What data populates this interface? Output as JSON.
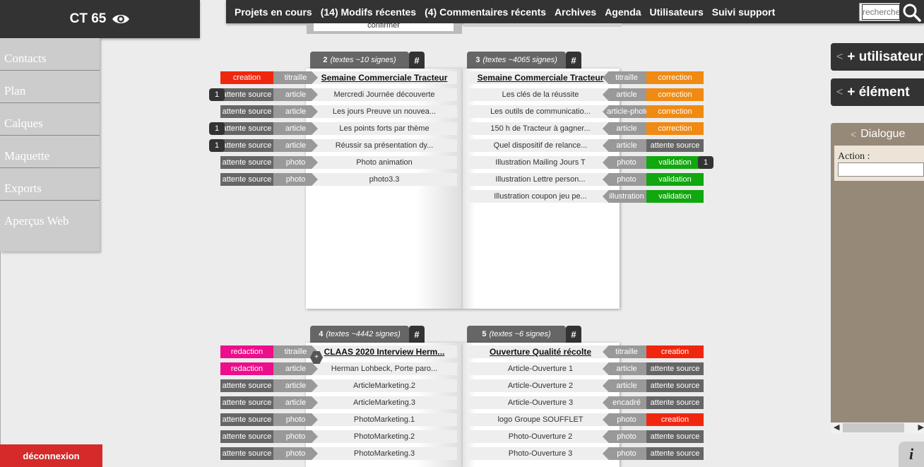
{
  "app": {
    "title": "CT 65",
    "eye_icon": "eye-icon"
  },
  "topnav": {
    "items": [
      "Projets en cours",
      "(14) Modifs récentes",
      "(4) Commentaires récents",
      "Archives",
      "Agenda",
      "Utilisateurs",
      "Suivi support"
    ],
    "search_placeholder": "recherche"
  },
  "confirm_label": "confirmer",
  "leftmenu": [
    "Contacts",
    "Plan",
    "Calques",
    "Maquette",
    "Exports",
    "Aperçus Web"
  ],
  "logout_label": "déconnexion",
  "colors": {
    "creation": "#f0270f",
    "redaction": "#ec0e8b",
    "source": "#666666",
    "correction": "#f08a12",
    "validation": "#10a70f",
    "type": "#999999"
  },
  "pages": [
    {
      "num": "2",
      "info": "(textes ~10 signes)",
      "hash": "#",
      "rows": [
        {
          "title": "Semaine Commerciale Tracteur",
          "headline": true,
          "type": "titraille",
          "status": "creation",
          "status_kind": "creation"
        },
        {
          "title": "Mercredi Journée découverte",
          "type": "article",
          "status": "attente source",
          "status_kind": "source",
          "count": "1"
        },
        {
          "title": "Les jours Preuve un nouvea...",
          "type": "article",
          "status": "attente source",
          "status_kind": "source"
        },
        {
          "title": "Les points forts par thème",
          "type": "article",
          "status": "attente source",
          "status_kind": "source",
          "count": "1"
        },
        {
          "title": "Réussir sa présentation dy...",
          "type": "article",
          "status": "attente source",
          "status_kind": "source",
          "count": "1"
        },
        {
          "title": "Photo animation",
          "type": "photo",
          "status": "attente source",
          "status_kind": "source"
        },
        {
          "title": "photo3.3",
          "type": "photo",
          "status": "attente source",
          "status_kind": "source"
        }
      ]
    },
    {
      "num": "3",
      "info": "(textes ~4065 signes)",
      "hash": "#",
      "rows": [
        {
          "title": "Semaine Commerciale Tracteur",
          "headline": true,
          "type": "titraille",
          "status": "correction",
          "status_kind": "correction"
        },
        {
          "title": "Les clés de la réussite",
          "type": "article",
          "status": "correction",
          "status_kind": "correction"
        },
        {
          "title": "Les outils de communicatio...",
          "type": "article-photo",
          "status": "correction",
          "status_kind": "correction"
        },
        {
          "title": "150 h de Tracteur à gagner...",
          "type": "article",
          "status": "correction",
          "status_kind": "correction"
        },
        {
          "title": "Quel dispositif de relance...",
          "type": "article",
          "status": "attente source",
          "status_kind": "source"
        },
        {
          "title": "Illustration Mailing Jours T",
          "type": "photo",
          "status": "validation",
          "status_kind": "validation",
          "count": "1"
        },
        {
          "title": "Illustration Lettre person...",
          "type": "photo",
          "status": "validation",
          "status_kind": "validation"
        },
        {
          "title": "Illustration coupon jeu pe...",
          "type": "illustration",
          "status": "validation",
          "status_kind": "validation"
        }
      ]
    },
    {
      "num": "4",
      "info": "(textes ~4442 signes)",
      "hash": "#",
      "rows": [
        {
          "title": "CLAAS 2020 Interview Herm...",
          "headline": true,
          "type": "titraille",
          "status": "redaction",
          "status_kind": "redaction"
        },
        {
          "title": "Herman Lohbeck, Porte paro...",
          "type": "article",
          "status": "redaction",
          "status_kind": "redaction"
        },
        {
          "title": "ArticleMarketing.2",
          "type": "article",
          "status": "attente source",
          "status_kind": "source"
        },
        {
          "title": "ArticleMarketing.3",
          "type": "article",
          "status": "attente source",
          "status_kind": "source"
        },
        {
          "title": "PhotoMarketing.1",
          "type": "photo",
          "status": "attente source",
          "status_kind": "source"
        },
        {
          "title": "PhotoMarketing.2",
          "type": "photo",
          "status": "attente source",
          "status_kind": "source"
        },
        {
          "title": "PhotoMarketing.3",
          "type": "photo",
          "status": "attente source",
          "status_kind": "source"
        }
      ],
      "plus": "+"
    },
    {
      "num": "5",
      "info": "(textes ~6 signes)",
      "hash": "#",
      "rows": [
        {
          "title": "Ouverture Qualité récolte",
          "headline": true,
          "type": "titraille",
          "status": "creation",
          "status_kind": "creation"
        },
        {
          "title": "Article-Ouverture 1",
          "type": "article",
          "status": "attente source",
          "status_kind": "source"
        },
        {
          "title": "Article-Ouverture 2",
          "type": "article",
          "status": "attente source",
          "status_kind": "source"
        },
        {
          "title": "Article-Ouverture 3",
          "type": "encadré",
          "status": "attente source",
          "status_kind": "source"
        },
        {
          "title": "logo Groupe SOUFFLET",
          "type": "photo",
          "status": "creation",
          "status_kind": "creation"
        },
        {
          "title": "Photo-Ouverture 2",
          "type": "photo",
          "status": "attente source",
          "status_kind": "source"
        },
        {
          "title": "Photo-Ouverture 3",
          "type": "photo",
          "status": "attente source",
          "status_kind": "source"
        }
      ]
    }
  ],
  "side": {
    "add_user": "+ utilisateur",
    "add_element": "+ élément",
    "dialog_title": "Dialogue",
    "action_label": "Action :",
    "chevron": "<"
  },
  "info_label": "i"
}
